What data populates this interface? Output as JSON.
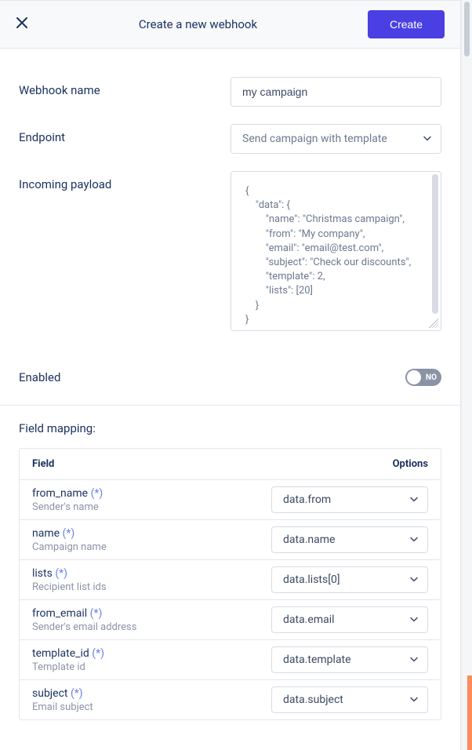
{
  "header": {
    "title": "Create a new webhook",
    "create_label": "Create"
  },
  "form": {
    "webhook_name_label": "Webhook name",
    "webhook_name_value": "my campaign",
    "endpoint_label": "Endpoint",
    "endpoint_value": "Send campaign with template",
    "payload_label": "Incoming payload",
    "payload_value": "{\n    \"data\": {\n        \"name\": \"Christmas campaign\",\n        \"from\": \"My company\",\n        \"email\": \"email@test.com\",\n        \"subject\": \"Check our discounts\",\n        \"template\": 2,\n        \"lists\": [20]\n    }\n}",
    "enabled_label": "Enabled",
    "enabled_value": false,
    "enabled_no_text": "NO"
  },
  "mapping": {
    "title": "Field mapping:",
    "col_field": "Field",
    "col_options": "Options",
    "required_marker": "(*)",
    "rows": [
      {
        "field": "from_name",
        "required": true,
        "desc": "Sender's name",
        "value": "data.from"
      },
      {
        "field": "name",
        "required": true,
        "desc": "Campaign name",
        "value": "data.name"
      },
      {
        "field": "lists",
        "required": true,
        "desc": "Recipient list ids",
        "value": "data.lists[0]"
      },
      {
        "field": "from_email",
        "required": true,
        "desc": "Sender's email address",
        "value": "data.email"
      },
      {
        "field": "template_id",
        "required": true,
        "desc": "Template id",
        "value": "data.template"
      },
      {
        "field": "subject",
        "required": true,
        "desc": "Email subject",
        "value": "data.subject"
      }
    ]
  },
  "colors": {
    "primary_button": "#4a3fe3",
    "accent_scroll": "#ff8a5c",
    "text_primary": "#1b325f",
    "text_muted": "#8a94a6",
    "border": "#d7dbe3"
  }
}
